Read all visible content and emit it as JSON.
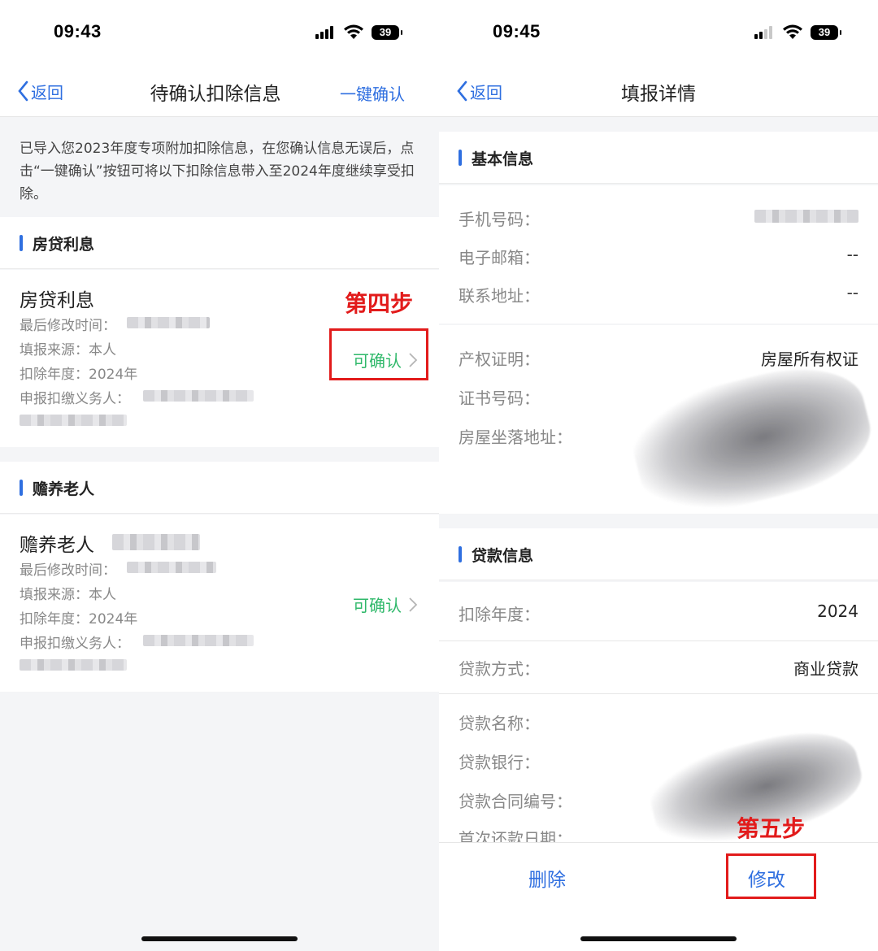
{
  "left": {
    "status": {
      "time": "09:43",
      "battery": "39"
    },
    "nav": {
      "back": "返回",
      "title": "待确认扣除信息",
      "action": "一键确认"
    },
    "notice": "已导入您2023年度专项附加扣除信息，在您确认信息无误后，点击“一键确认”按钮可将以下扣除信息带入至2024年度继续享受扣除。",
    "sections": [
      {
        "header": "房贷利息",
        "card": {
          "title": "房贷利息",
          "modified_label": "最后修改时间：",
          "source": "填报来源：本人",
          "year": "扣除年度：2024年",
          "withholder_label": "申报扣缴义务人：",
          "action": "可确认"
        }
      },
      {
        "header": "赡养老人",
        "card": {
          "title": "赡养老人",
          "modified_label": "最后修改时间：",
          "source": "填报来源：本人",
          "year": "扣除年度：2024年",
          "withholder_label": "申报扣缴义务人：",
          "action": "可确认"
        }
      }
    ],
    "annotation": "第四步"
  },
  "right": {
    "status": {
      "time": "09:45",
      "battery": "39"
    },
    "nav": {
      "back": "返回",
      "title": "填报详情"
    },
    "basic": {
      "header": "基本信息",
      "phone_label": "手机号码：",
      "email_label": "电子邮箱：",
      "email_value": "--",
      "address_label": "联系地址：",
      "address_value": "--",
      "cert_label": "产权证明：",
      "cert_value": "房屋所有权证",
      "certno_label": "证书号码：",
      "location_label": "房屋坐落地址："
    },
    "loan": {
      "header": "贷款信息",
      "year_label": "扣除年度：",
      "year_value": "2024",
      "type_label": "贷款方式：",
      "type_value": "商业贷款",
      "name_label": "贷款名称：",
      "bank_label": "贷款银行：",
      "contract_label": "贷款合同编号：",
      "first_label": "首次还款日期："
    },
    "buttons": {
      "delete": "删除",
      "edit": "修改"
    },
    "annotation": "第五步"
  },
  "colors": {
    "accent": "#2f6fe0",
    "confirm": "#2fb86a",
    "annotation": "#e21b1b"
  }
}
